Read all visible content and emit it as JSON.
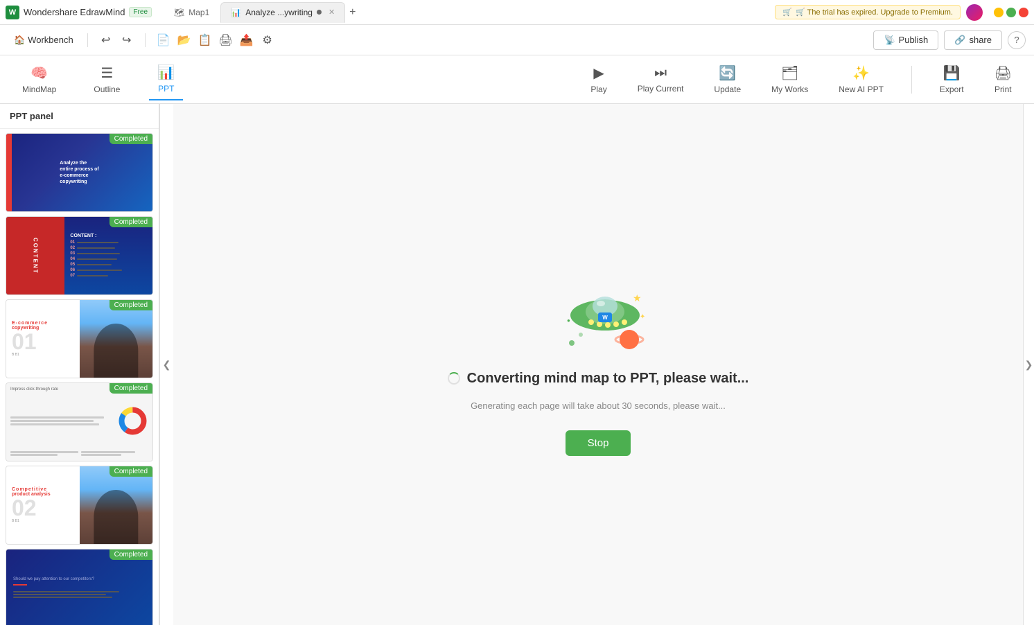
{
  "titleBar": {
    "appName": "Wondershare EdrawMind",
    "badge": "Free",
    "tabs": [
      {
        "label": "Map1",
        "icon": "🗺",
        "active": false,
        "closable": false
      },
      {
        "label": "Analyze ...ywriting",
        "icon": "📊",
        "active": true,
        "closable": true
      }
    ],
    "trialBanner": "🛒 The trial has expired. Upgrade to Premium.",
    "windowControls": [
      "minimize",
      "maximize",
      "close"
    ]
  },
  "toolbar": {
    "workbench": "Workbench",
    "publish": "Publish",
    "share": "share",
    "icons": [
      "undo",
      "redo",
      "new",
      "open",
      "template",
      "print",
      "export",
      "settings"
    ]
  },
  "viewTabs": {
    "items": [
      {
        "label": "MindMap",
        "active": false
      },
      {
        "label": "Outline",
        "active": false
      },
      {
        "label": "PPT",
        "active": true
      }
    ],
    "rightItems": [
      {
        "label": "Play"
      },
      {
        "label": "Play Current"
      },
      {
        "label": "Update"
      },
      {
        "label": "My Works"
      },
      {
        "label": "New AI PPT"
      }
    ],
    "exportLabel": "Export",
    "printLabel": "Print"
  },
  "pptPanel": {
    "title": "PPT panel",
    "slides": [
      {
        "id": 1,
        "status": "Completed",
        "type": "title-slide",
        "title": "Analyze the entire process of e-commerce copywriting"
      },
      {
        "id": 2,
        "status": "Completed",
        "type": "content-slide",
        "title": "CONTENT :"
      },
      {
        "id": 3,
        "status": "Completed",
        "type": "part01-slide",
        "bigNum": "01",
        "label": "E-commerce copywriting",
        "partLabel": "PART 01"
      },
      {
        "id": 4,
        "status": "Completed",
        "type": "stats-slide",
        "title": "Impress click-through rate"
      },
      {
        "id": 5,
        "status": "Completed",
        "type": "part02-slide",
        "bigNum": "02",
        "label": "Competitive product analysis",
        "partLabel": "PART 02"
      },
      {
        "id": 6,
        "status": "Completed",
        "type": "qa-slide",
        "small": "Should we pay attention to our competitors?",
        "title": "Should we pay attention to our competitors?"
      }
    ]
  },
  "mainContent": {
    "convertingTitle": "Converting mind map to PPT, please wait...",
    "convertingSubtitle": "Generating each page will take about 30 seconds, please wait...",
    "stopLabel": "Stop"
  },
  "collapse": {
    "icon": "❮"
  },
  "rightPanel": {
    "icon": "❯"
  }
}
